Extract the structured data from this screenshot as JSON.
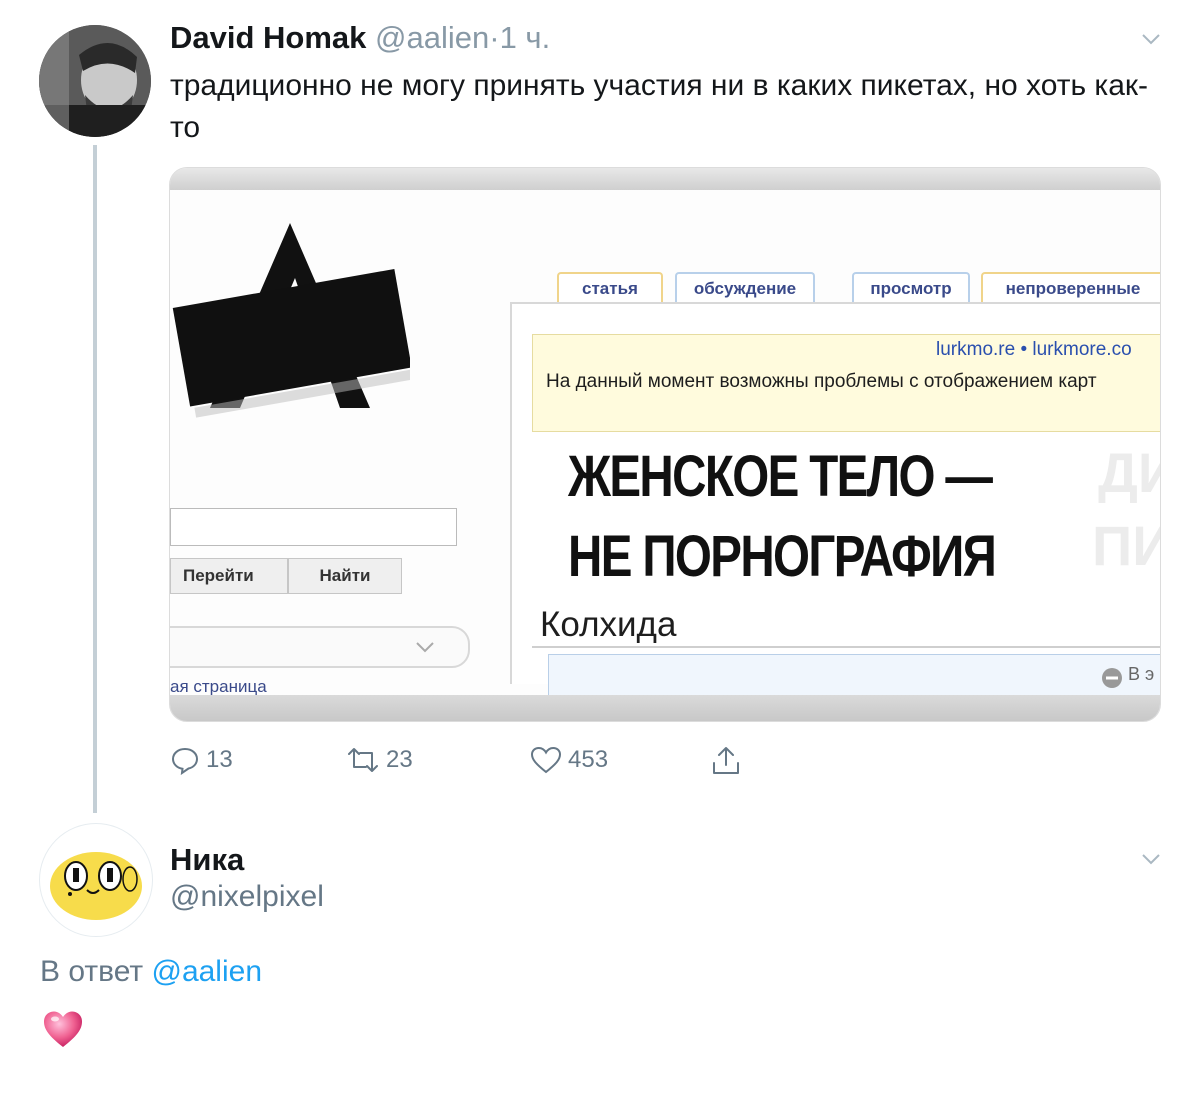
{
  "tweet1": {
    "author_name": "David Homak",
    "handle": "@aalien",
    "separator": "·",
    "time": "1 ч.",
    "text": "традиционно не могу принять участия ни в каких пикетах, но хоть как-то",
    "media": {
      "tabs": [
        "статья",
        "обсуждение",
        "просмотр",
        "непроверенные"
      ],
      "notice_links": "lurkmo.re • lurkmore.co",
      "notice_text": "На данный момент возможны проблемы с отображением карт",
      "headline_line1": "ЖЕНСКОЕ ТЕЛО —",
      "headline_line2": "НЕ ПОРНОГРАФИЯ",
      "ghost_text_1": "ДИ",
      "ghost_text_2": "ПИЗ",
      "section_title": "Колхида",
      "button_go": "Перейти",
      "button_find": "Найти",
      "side_link": "ая страница",
      "select_value": "",
      "box_label": "В э"
    },
    "actions": {
      "replies": "13",
      "retweets": "23",
      "likes": "453"
    }
  },
  "tweet2": {
    "author_name": "Ника",
    "handle": "@nixelpixel",
    "reply_prefix": "В ответ",
    "reply_to": "@aalien",
    "text_emoji": "heart-emoji"
  },
  "colors": {
    "link_blue": "#1da1f2",
    "secondary_text": "#657786",
    "thread_line": "#c4cfd6",
    "emoji_pink": "#f06292"
  }
}
